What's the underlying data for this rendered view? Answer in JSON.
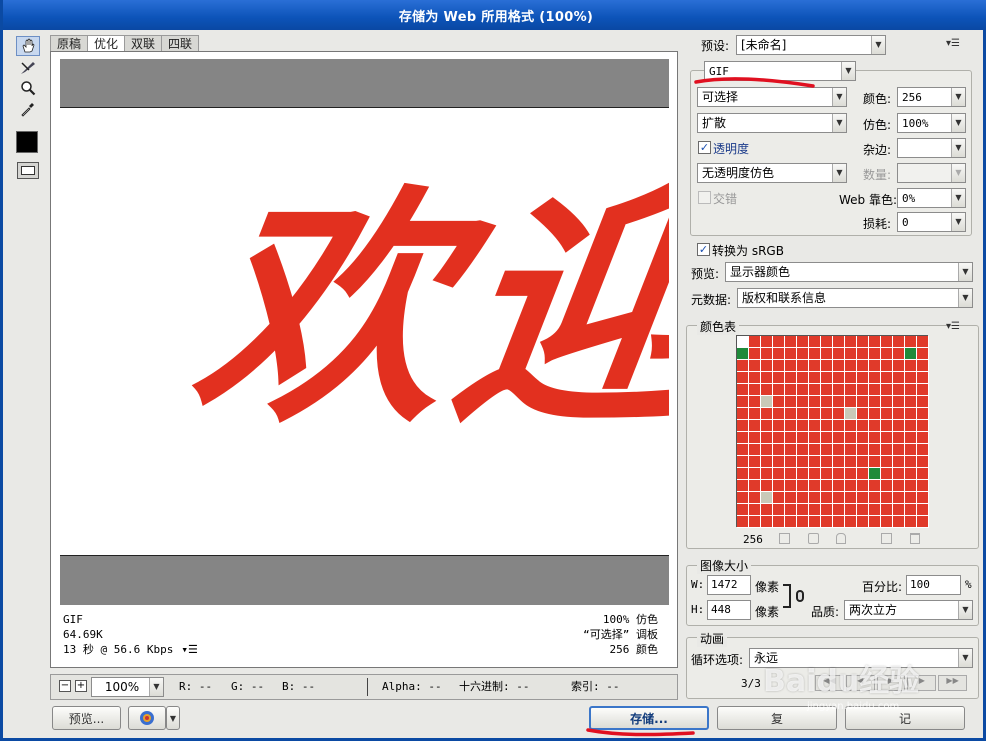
{
  "window": {
    "title": "存储为 Web 所用格式 (100%)"
  },
  "tools": [
    "hand-tool-icon",
    "slice-select-tool-icon",
    "zoom-tool-icon",
    "eyedropper-tool-icon"
  ],
  "tabs": [
    "原稿",
    "优化",
    "双联",
    "四联"
  ],
  "canvas": {
    "text": "欢迎",
    "text_color": "#e2301f"
  },
  "info_left": [
    "GIF",
    "64.69K",
    "13 秒 @ 56.6 Kbps"
  ],
  "info_right": [
    "100% 仿色",
    "“可选择” 调板",
    "256 颜色"
  ],
  "zoom": {
    "value": "100%",
    "minus": "−",
    "plus": "+"
  },
  "readout": {
    "r": "R: --",
    "g": "G: --",
    "b": "B: --",
    "alpha": "Alpha: --",
    "hex": "十六进制: --",
    "index": "索引: --"
  },
  "buttons": {
    "preview": "预览...",
    "save": "存储...",
    "reset": "复",
    "remember": "记"
  },
  "preset": {
    "label": "预设:",
    "value": "[未命名]"
  },
  "format": {
    "value": "GIF"
  },
  "reduction": {
    "value": "可选择"
  },
  "dither_algo": {
    "value": "扩散"
  },
  "colors": {
    "label": "颜色:",
    "value": "256"
  },
  "dither": {
    "label": "仿色:",
    "value": "100%"
  },
  "transparency": {
    "label": "透明度",
    "checked": true
  },
  "matte": {
    "label": "杂边:",
    "value": ""
  },
  "transparency_dither": {
    "value": "无透明度仿色"
  },
  "amount": {
    "label": "数量:",
    "value": ""
  },
  "interlaced": {
    "label": "交错",
    "checked": false
  },
  "web_snap": {
    "label": "Web 靠色:",
    "value": "0%"
  },
  "lossy": {
    "label": "损耗:",
    "value": "0"
  },
  "convert_srgb": {
    "label": "转换为 sRGB",
    "checked": true
  },
  "preview_mode": {
    "label": "预览:",
    "value": "显示器颜色"
  },
  "metadata": {
    "label": "元数据:",
    "value": "版权和联系信息"
  },
  "color_table": {
    "title": "颜色表",
    "count": "256"
  },
  "image_size": {
    "title": "图像大小",
    "w_label": "W:",
    "w_value": "1472",
    "h_label": "H:",
    "h_value": "448",
    "unit": "像素",
    "percent_label": "百分比:",
    "percent_value": "100",
    "percent_unit": "%",
    "quality_label": "品质:",
    "quality_value": "两次立方"
  },
  "animation": {
    "title": "动画",
    "loop_label": "循环选项:",
    "loop_value": "永远",
    "frame": "3/3"
  },
  "watermark": {
    "text": "Baidu经验",
    "sub": "jingyan.baidu.com"
  }
}
